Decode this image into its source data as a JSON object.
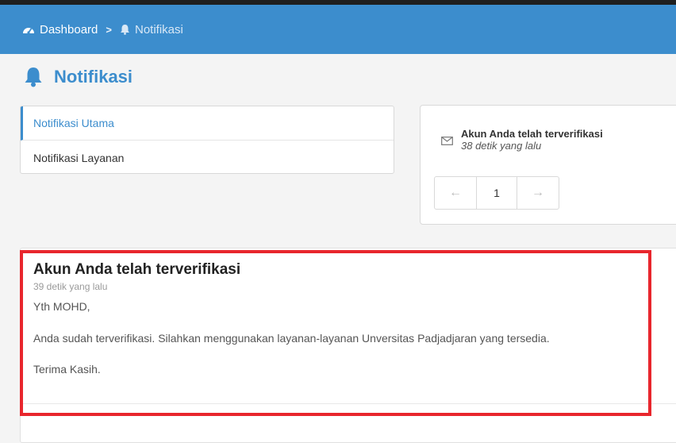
{
  "breadcrumb": {
    "home_icon": "dashboard-icon",
    "home_label": "Dashboard",
    "separator": ">",
    "current_icon": "bell-icon",
    "current_label": "Notifikasi"
  },
  "page": {
    "title_icon": "bell-icon",
    "title": "Notifikasi"
  },
  "sidebar": {
    "items": [
      {
        "label": "Notifikasi Utama",
        "active": true
      },
      {
        "label": "Notifikasi Layanan",
        "active": false
      }
    ]
  },
  "notification_panel": {
    "icon": "envelope-icon",
    "title": "Akun Anda telah terverifikasi",
    "time": "38 detik yang lalu",
    "pagination": {
      "prev_icon": "arrow-left-icon",
      "page": "1",
      "next_icon": "arrow-right-icon"
    }
  },
  "detail": {
    "title": "Akun Anda telah terverifikasi",
    "time": "39 detik yang lalu",
    "greeting": "Yth MOHD,",
    "message": "Anda sudah terverifikasi. Silahkan menggunakan layanan-layanan Unversitas Padjadjaran yang tersedia.",
    "closing": "Terima Kasih."
  },
  "colors": {
    "primary": "#3c8dcd",
    "highlight": "#e8262d"
  }
}
